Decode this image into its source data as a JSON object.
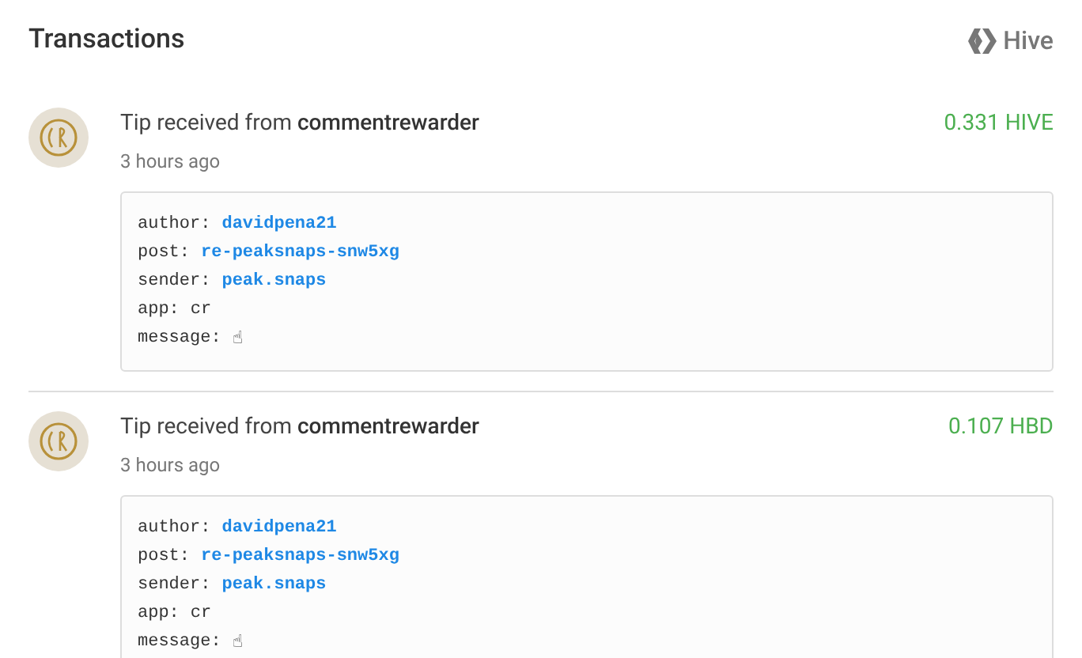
{
  "title": "Transactions",
  "network": {
    "label": "Hive"
  },
  "transactions": [
    {
      "prefix": "Tip received from",
      "sender": "commentrewarder",
      "time": "3 hours ago",
      "amount": "0.331 HIVE",
      "details": [
        {
          "key": "author:",
          "value": "davidpena21",
          "kind": "link"
        },
        {
          "key": "post:",
          "value": "re-peaksnaps-snw5xg",
          "kind": "link"
        },
        {
          "key": "sender:",
          "value": "peak.snaps",
          "kind": "link"
        },
        {
          "key": "app:",
          "value": "cr",
          "kind": "plain"
        },
        {
          "key": "message:",
          "value": "☝",
          "kind": "plain"
        }
      ]
    },
    {
      "prefix": "Tip received from",
      "sender": "commentrewarder",
      "time": "3 hours ago",
      "amount": "0.107 HBD",
      "details": [
        {
          "key": "author:",
          "value": "davidpena21",
          "kind": "link"
        },
        {
          "key": "post:",
          "value": "re-peaksnaps-snw5xg",
          "kind": "link"
        },
        {
          "key": "sender:",
          "value": "peak.snaps",
          "kind": "link"
        },
        {
          "key": "app:",
          "value": "cr",
          "kind": "plain"
        },
        {
          "key": "message:",
          "value": "☝",
          "kind": "plain"
        }
      ]
    }
  ]
}
